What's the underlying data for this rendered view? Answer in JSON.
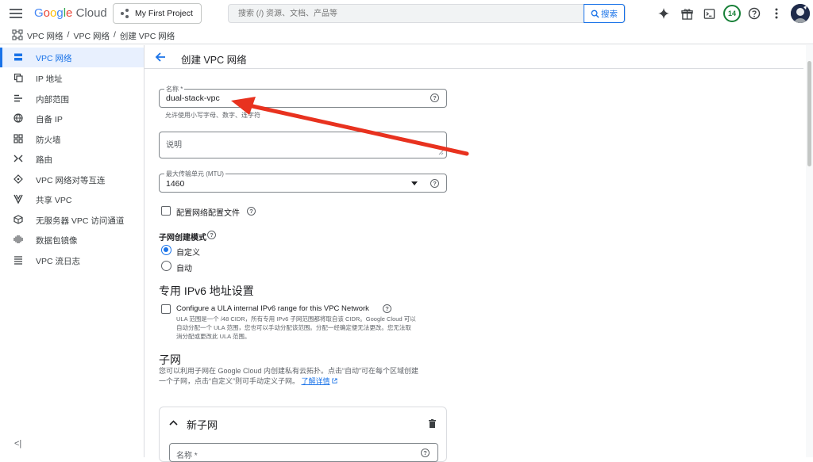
{
  "topbar": {
    "logo": {
      "g": "G",
      "o1": "o",
      "o2": "o",
      "g2": "g",
      "l": "l",
      "e": "e",
      "cloud": "Cloud"
    },
    "project": "My First Project",
    "search_placeholder": "搜索 (/) 资源、文档、产品等",
    "search_button": "搜索",
    "notification_count": "14"
  },
  "breadcrumb": [
    "VPC 网络",
    "/",
    "VPC 网络",
    "/",
    "创建 VPC 网络"
  ],
  "sidebar": {
    "items": [
      {
        "label": "VPC 网络",
        "icon": "vpc-icon",
        "active": true
      },
      {
        "label": "IP 地址",
        "icon": "ip-address-icon"
      },
      {
        "label": "内部范围",
        "icon": "internal-range-icon"
      },
      {
        "label": "自备 IP",
        "icon": "globe-icon"
      },
      {
        "label": "防火墙",
        "icon": "firewall-icon"
      },
      {
        "label": "路由",
        "icon": "route-icon"
      },
      {
        "label": "VPC 网络对等互连",
        "icon": "peering-icon"
      },
      {
        "label": "共享 VPC",
        "icon": "shared-vpc-icon"
      },
      {
        "label": "无服务器 VPC 访问通道",
        "icon": "serverless-icon"
      },
      {
        "label": "数据包镜像",
        "icon": "packet-mirroring-icon"
      },
      {
        "label": "VPC 流日志",
        "icon": "flow-logs-icon"
      }
    ],
    "collapse_label": "<|"
  },
  "page": {
    "title": "创建 VPC 网络",
    "name_label": "名称 *",
    "name_value": "dual-stack-vpc",
    "name_hint": "允许使用小写字母、数字、连字符",
    "description_placeholder": "说明",
    "mtu_label": "最大传输单元 (MTU)",
    "mtu_value": "1460",
    "network_profile_label": "配置网络配置文件",
    "subnet_mode_title": "子网创建模式",
    "subnet_mode_custom": "自定义",
    "subnet_mode_auto": "自动",
    "ipv6_title": "专用 IPv6 地址设置",
    "ula_label": "Configure a ULA internal IPv6 range for this VPC Network",
    "ula_desc_1": "ULA 范围是一个 /48 CIDR，所有专用 IPv6 子网范围都将取自该 CIDR。Google Cloud 可以",
    "ula_desc_2": "自动分配一个 ULA 范围，您也可以手动分配该范围。分配一经确定便无法更改。您无法取",
    "ula_desc_3": "消分配或更改此 ULA 范围。",
    "subnet_title": "子网",
    "subnet_desc_1": "您可以利用子网在 Google Cloud 内创建私有云拓扑。点击“自动”可在每个区域创建",
    "subnet_desc_2": "一个子网，点击“自定义”则可手动定义子网。",
    "learn_more": "了解详情",
    "new_subnet_title": "新子网",
    "new_subnet_name_label": "名称 *"
  },
  "colors": {
    "accent": "#1a73e8",
    "arrow": "#e8321f",
    "badge": "#188038"
  }
}
